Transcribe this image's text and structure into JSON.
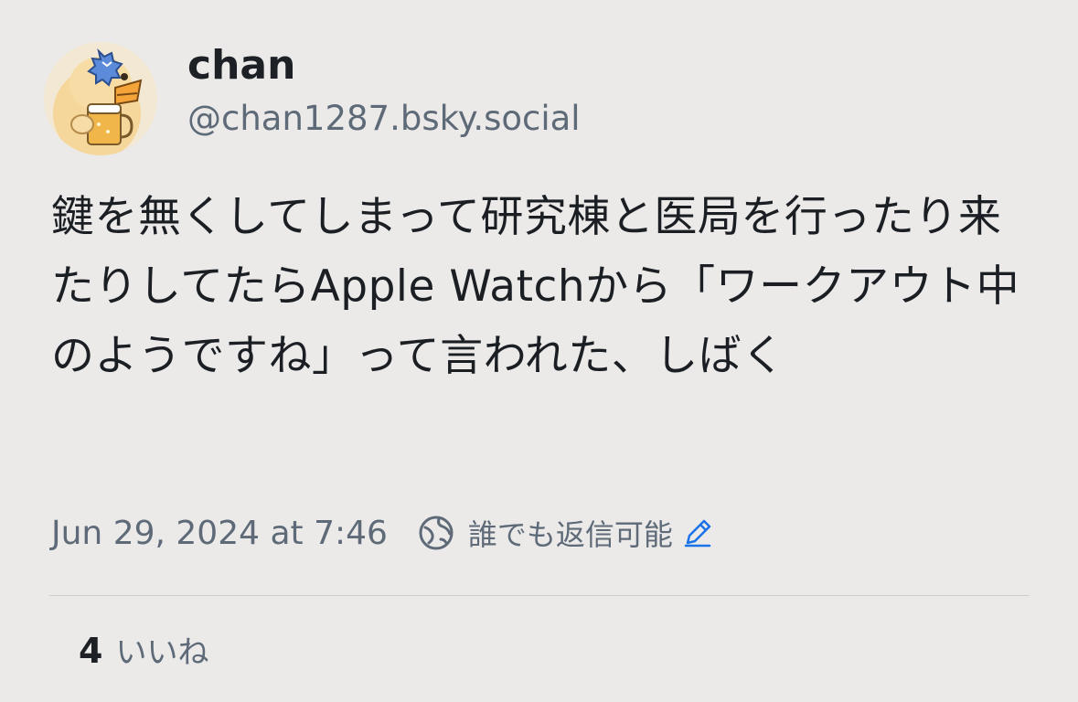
{
  "author": {
    "display_name": "chan",
    "handle": "@chan1287.bsky.social",
    "avatar_icon": "duck-holding-beer-avatar"
  },
  "post": {
    "text": "鍵を無くしてしまって研究棟と医局を行ったり来たりしてたらApple Watchから「ワークアウト中のようですね」って言われた、しばく"
  },
  "meta": {
    "timestamp": "Jun 29, 2024 at 7:46",
    "reply_setting_label": "誰でも返信可能",
    "globe_icon": "globe-icon",
    "edit_icon": "pencil-icon"
  },
  "stats": {
    "like_count": "4",
    "like_label": "いいね"
  },
  "colors": {
    "background": "#ebeae9",
    "text_primary": "#1b1f24",
    "text_secondary": "#5e6a78",
    "accent_blue": "#1a73e8"
  }
}
